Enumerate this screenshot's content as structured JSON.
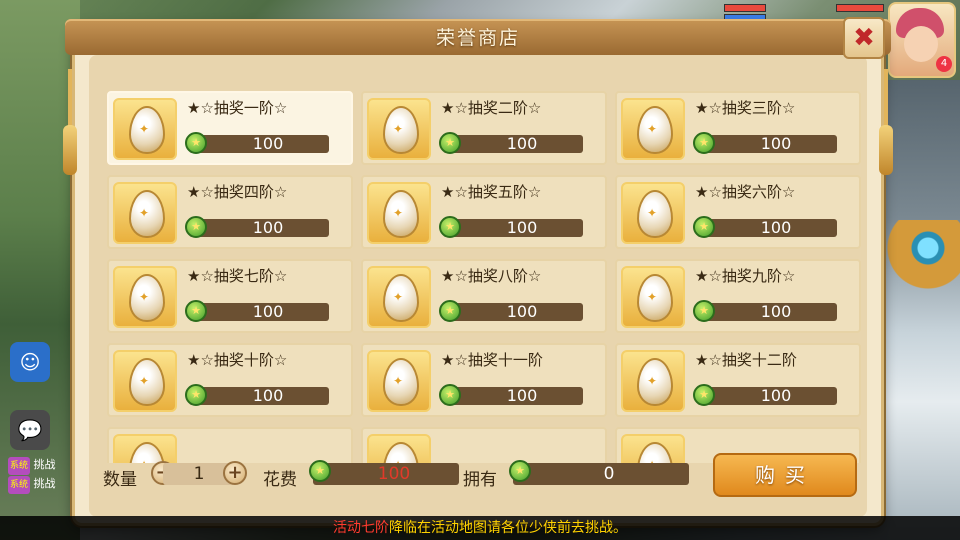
{
  "shop": {
    "title": "荣誉商店",
    "close_icon": "✖",
    "items": [
      {
        "name": "★☆抽奖一阶☆",
        "price": "100",
        "selected": true
      },
      {
        "name": "★☆抽奖二阶☆",
        "price": "100"
      },
      {
        "name": "★☆抽奖三阶☆",
        "price": "100"
      },
      {
        "name": "★☆抽奖四阶☆",
        "price": "100"
      },
      {
        "name": "★☆抽奖五阶☆",
        "price": "100"
      },
      {
        "name": "★☆抽奖六阶☆",
        "price": "100"
      },
      {
        "name": "★☆抽奖七阶☆",
        "price": "100"
      },
      {
        "name": "★☆抽奖八阶☆",
        "price": "100"
      },
      {
        "name": "★☆抽奖九阶☆",
        "price": "100"
      },
      {
        "name": "★☆抽奖十阶☆",
        "price": "100"
      },
      {
        "name": "★☆抽奖十一阶",
        "price": "100"
      },
      {
        "name": "★☆抽奖十二阶",
        "price": "100"
      },
      {
        "name": "",
        "price": ""
      },
      {
        "name": "",
        "price": ""
      },
      {
        "name": "",
        "price": ""
      }
    ],
    "footer": {
      "quantity_label": "数量",
      "minus": "−",
      "quantity": "1",
      "plus": "+",
      "cost_label": "花费",
      "cost": "100",
      "own_label": "拥有",
      "own": "0",
      "buy_label": "购买"
    }
  },
  "ticker": {
    "red_part": "活动七阶",
    "yellow_part": "降临在活动地图请各位少侠前去挑战。"
  },
  "hud": {
    "chat_lines": [
      {
        "tag": "系统",
        "text": "挑战"
      },
      {
        "tag": "系统",
        "text": "挑战"
      }
    ],
    "avatar_badge": "4"
  },
  "colors": {
    "panel_bg": "#f4e8cc",
    "title_bar": "#b07f42",
    "price_bar": "#6b5032",
    "buy_button": "#e0891d",
    "cost_text": "#c0282a"
  }
}
